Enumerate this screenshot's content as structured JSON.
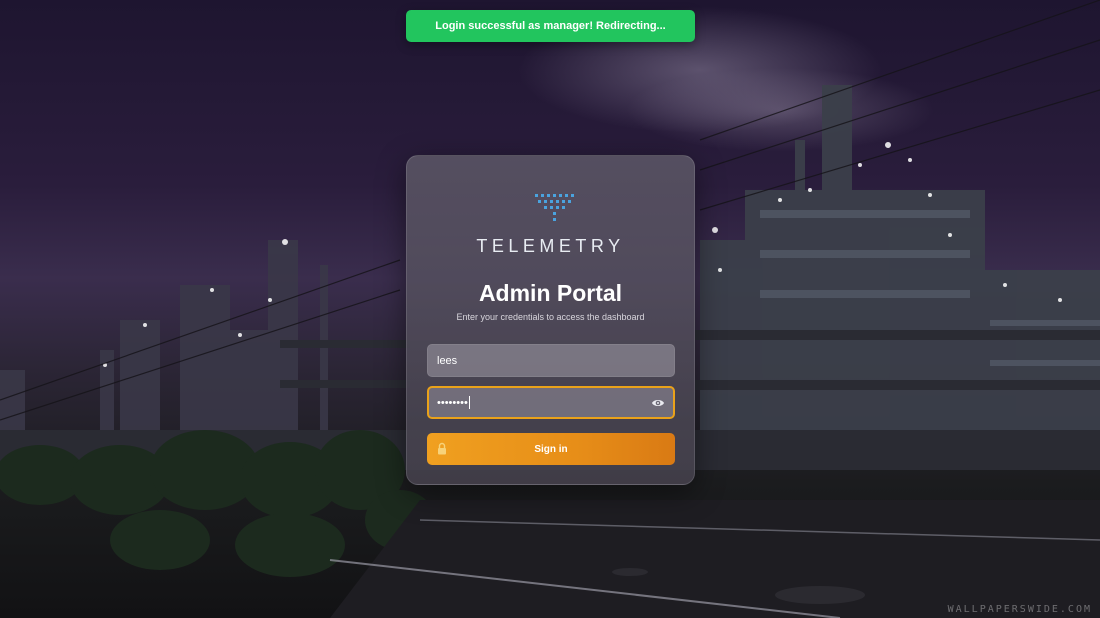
{
  "toast": {
    "message": "Login successful as manager! Redirecting...",
    "color": "#22c55e"
  },
  "brand": {
    "name": "TELEMETRY",
    "logo_icon": "telemetry-logo-icon"
  },
  "login": {
    "title": "Admin Portal",
    "subtitle": "Enter your credentials to access the dashboard",
    "username_value": "lees",
    "password_mask": "••••••••",
    "show_password_icon": "eye-icon",
    "signin_label": "Sign in",
    "signin_icon": "lock-icon",
    "accent_color": "#eaa21a"
  },
  "background": {
    "watermark": "WALLPAPERSWIDE.COM"
  }
}
